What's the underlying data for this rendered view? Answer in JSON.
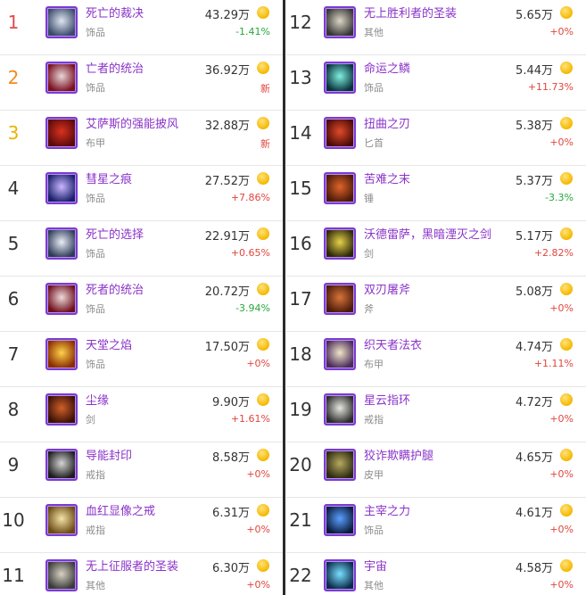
{
  "left": [
    {
      "rank": "1",
      "name": "死亡的裁决",
      "type": "饰品",
      "price": "43.29万",
      "change": "-1.41%",
      "dir": "down",
      "icon": "skull-icon",
      "c1": "#3a4a6a",
      "c2": "#dfe6f0"
    },
    {
      "rank": "2",
      "name": "亡者的统治",
      "type": "饰品",
      "price": "36.92万",
      "change": "新",
      "dir": "new",
      "icon": "crimson-banner-icon",
      "c1": "#7a0f1f",
      "c2": "#e7d6d8"
    },
    {
      "rank": "3",
      "name": "艾萨斯的强能披风",
      "type": "布甲",
      "price": "32.88万",
      "change": "新",
      "dir": "new",
      "icon": "red-cloak-icon",
      "c1": "#5a0a0a",
      "c2": "#d8321f"
    },
    {
      "rank": "4",
      "name": "彗星之痕",
      "type": "饰品",
      "price": "27.52万",
      "change": "+7.86%",
      "dir": "up",
      "icon": "comet-icon",
      "c1": "#1a1f6a",
      "c2": "#c9b6ff"
    },
    {
      "rank": "5",
      "name": "死亡的选择",
      "type": "饰品",
      "price": "22.91万",
      "change": "+0.65%",
      "dir": "up",
      "icon": "skull-icon",
      "c1": "#2e3b58",
      "c2": "#e9eef6"
    },
    {
      "rank": "6",
      "name": "死者的统治",
      "type": "饰品",
      "price": "20.72万",
      "change": "-3.94%",
      "dir": "down",
      "icon": "crimson-banner-icon",
      "c1": "#6e0e1c",
      "c2": "#eddada"
    },
    {
      "rank": "7",
      "name": "天堂之焰",
      "type": "饰品",
      "price": "17.50万",
      "change": "+0%",
      "dir": "up",
      "icon": "flame-icon",
      "c1": "#8a2c00",
      "c2": "#ffd24a"
    },
    {
      "rank": "8",
      "name": "尘缘",
      "type": "剑",
      "price": "9.90万",
      "change": "+1.61%",
      "dir": "up",
      "icon": "sword-icon",
      "c1": "#3a1005",
      "c2": "#d0602a"
    },
    {
      "rank": "9",
      "name": "导能封印",
      "type": "戒指",
      "price": "8.58万",
      "change": "+0%",
      "dir": "up",
      "icon": "claw-ring-icon",
      "c1": "#1c1c1c",
      "c2": "#d4d4d4"
    },
    {
      "rank": "10",
      "name": "血红显像之戒",
      "type": "戒指",
      "price": "6.31万",
      "change": "+0%",
      "dir": "up",
      "icon": "gold-ring-icon",
      "c1": "#6a4a12",
      "c2": "#f5e3a8"
    },
    {
      "rank": "11",
      "name": "无上征服者的圣装",
      "type": "其他",
      "price": "6.30万",
      "change": "+0%",
      "dir": "up",
      "icon": "armor-icon",
      "c1": "#3a3a3a",
      "c2": "#d8d2c2"
    }
  ],
  "right": [
    {
      "rank": "12",
      "name": "无上胜利者的圣装",
      "type": "其他",
      "price": "5.65万",
      "change": "+0%",
      "dir": "up",
      "icon": "armor-icon",
      "c1": "#353535",
      "c2": "#dcd6c6"
    },
    {
      "rank": "13",
      "name": "命运之鳞",
      "type": "饰品",
      "price": "5.44万",
      "change": "+11.73%",
      "dir": "up",
      "icon": "scale-icon",
      "c1": "#07303a",
      "c2": "#7ff0e0"
    },
    {
      "rank": "14",
      "name": "扭曲之刃",
      "type": "匕首",
      "price": "5.38万",
      "change": "+0%",
      "dir": "up",
      "icon": "dagger-icon",
      "c1": "#4a0a06",
      "c2": "#e04a2a"
    },
    {
      "rank": "15",
      "name": "苦难之末",
      "type": "锤",
      "price": "5.37万",
      "change": "-3.3%",
      "dir": "down",
      "icon": "mace-icon",
      "c1": "#4a1a08",
      "c2": "#e0642a"
    },
    {
      "rank": "16",
      "name": "沃德雷萨，黑暗湮灭之剑",
      "type": "剑",
      "price": "5.17万",
      "change": "+2.82%",
      "dir": "up",
      "icon": "sword-icon",
      "c1": "#2a2608",
      "c2": "#e6d24a"
    },
    {
      "rank": "17",
      "name": "双刃屠斧",
      "type": "斧",
      "price": "5.08万",
      "change": "+0%",
      "dir": "up",
      "icon": "axe-icon",
      "c1": "#4a1a0a",
      "c2": "#d8743a"
    },
    {
      "rank": "18",
      "name": "织天者法衣",
      "type": "布甲",
      "price": "4.74万",
      "change": "+1.11%",
      "dir": "up",
      "icon": "robe-icon",
      "c1": "#4a2a5a",
      "c2": "#f0e6c8"
    },
    {
      "rank": "19",
      "name": "星云指环",
      "type": "戒指",
      "price": "4.72万",
      "change": "+0%",
      "dir": "up",
      "icon": "nebula-ring-icon",
      "c1": "#2a2a2a",
      "c2": "#e8e8e0"
    },
    {
      "rank": "20",
      "name": "狡诈欺瞒护腿",
      "type": "皮甲",
      "price": "4.65万",
      "change": "+0%",
      "dir": "up",
      "icon": "leggings-icon",
      "c1": "#2a2a10",
      "c2": "#b8a860"
    },
    {
      "rank": "21",
      "name": "主宰之力",
      "type": "饰品",
      "price": "4.61万",
      "change": "+0%",
      "dir": "up",
      "icon": "blue-orb-icon",
      "c1": "#0a1a3a",
      "c2": "#5aa0ff"
    },
    {
      "rank": "22",
      "name": "宇宙",
      "type": "其他",
      "price": "4.58万",
      "change": "+0%",
      "dir": "up",
      "icon": "cosmos-icon",
      "c1": "#0a2a4a",
      "c2": "#7ae0ff"
    }
  ]
}
